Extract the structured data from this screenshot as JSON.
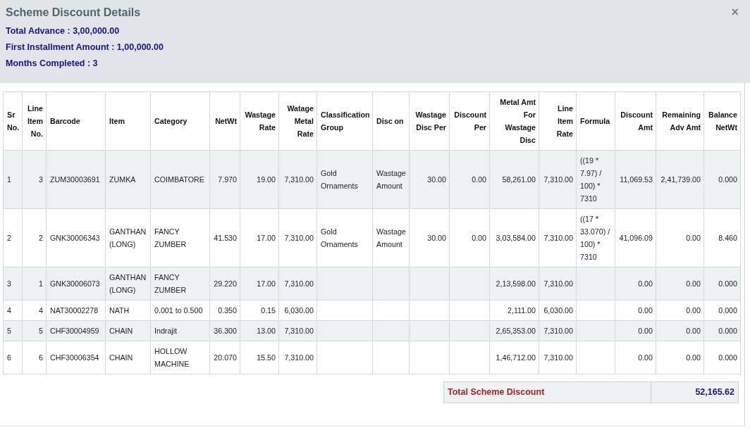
{
  "dialog": {
    "title": "Scheme Discount Details",
    "close": "×",
    "summary": [
      "Total Advance : 3,00,000.00",
      "First Installment Amount : 1,00,000.00",
      "Months Completed : 3"
    ]
  },
  "table": {
    "columns": [
      "Sr No.",
      "Line Item No.",
      "Barcode",
      "Item",
      "Category",
      "NetWt",
      "Wastage Rate",
      "Watage Metal Rate",
      "Classification Group",
      "Disc on",
      "Wastage Disc Per",
      "Discount Per",
      "Metal Amt For Wastage Disc",
      "Line Item Rate",
      "Formula",
      "Discount Amt",
      "Remaining Adv Amt",
      "Balance NetWt"
    ],
    "rows": [
      {
        "sr_no": "1",
        "line_item_no": "3",
        "barcode": "ZUM30003691",
        "item": "ZUMKA",
        "category": "COIMBATORE",
        "net_wt": "7.970",
        "wastage_rate": "19.00",
        "watage_metal_rate": "7,310.00",
        "classification_group": "Gold Ornaments",
        "disc_on": "Wastage Amount",
        "wastage_disc_per": "30.00",
        "discount_per": "0.00",
        "metal_amt_for_wastage_disc": "58,261.00",
        "line_item_rate": "7,310.00",
        "formula": "((19 * 7.97) / 100) * 7310",
        "discount_amt": "11,069.53",
        "remaining_adv_amt": "2,41,739.00",
        "balance_net_wt": "0.000"
      },
      {
        "sr_no": "2",
        "line_item_no": "2",
        "barcode": "GNK30006343",
        "item": "GANTHAN (LONG)",
        "category": "FANCY ZUMBER",
        "net_wt": "41.530",
        "wastage_rate": "17.00",
        "watage_metal_rate": "7,310.00",
        "classification_group": "Gold Ornaments",
        "disc_on": "Wastage Amount",
        "wastage_disc_per": "30.00",
        "discount_per": "0.00",
        "metal_amt_for_wastage_disc": "3,03,584.00",
        "line_item_rate": "7,310.00",
        "formula": "((17 * 33.070) / 100) * 7310",
        "discount_amt": "41,096.09",
        "remaining_adv_amt": "0.00",
        "balance_net_wt": "8.460"
      },
      {
        "sr_no": "3",
        "line_item_no": "1",
        "barcode": "GNK30006073",
        "item": "GANTHAN (LONG)",
        "category": "FANCY ZUMBER",
        "net_wt": "29.220",
        "wastage_rate": "17.00",
        "watage_metal_rate": "7,310.00",
        "metal_amt_for_wastage_disc": "2,13,598.00",
        "line_item_rate": "7,310.00",
        "discount_amt": "0.00",
        "remaining_adv_amt": "0.00",
        "balance_net_wt": "0.000"
      },
      {
        "sr_no": "4",
        "line_item_no": "4",
        "barcode": "NAT30002278",
        "item": "NATH",
        "category": "0.001 to 0.500",
        "net_wt": "0.350",
        "wastage_rate": "0.15",
        "watage_metal_rate": "6,030.00",
        "metal_amt_for_wastage_disc": "2,111.00",
        "line_item_rate": "6,030.00",
        "discount_amt": "0.00",
        "remaining_adv_amt": "0.00",
        "balance_net_wt": "0.000"
      },
      {
        "sr_no": "5",
        "line_item_no": "5",
        "barcode": "CHF30004959",
        "item": "CHAIN",
        "category": "Indrajit",
        "net_wt": "36.300",
        "wastage_rate": "13.00",
        "watage_metal_rate": "7,310.00",
        "metal_amt_for_wastage_disc": "2,65,353.00",
        "line_item_rate": "7,310.00",
        "discount_amt": "0.00",
        "remaining_adv_amt": "0.00",
        "balance_net_wt": "0.000"
      },
      {
        "sr_no": "6",
        "line_item_no": "6",
        "barcode": "CHF30006354",
        "item": "CHAIN",
        "category": "HOLLOW MACHINE",
        "net_wt": "20.070",
        "wastage_rate": "15.50",
        "watage_metal_rate": "7,310.00",
        "metal_amt_for_wastage_disc": "1,46,712.00",
        "line_item_rate": "7,310.00",
        "discount_amt": "0.00",
        "remaining_adv_amt": "0.00",
        "balance_net_wt": "0.000"
      }
    ]
  },
  "total": {
    "label": "Total Scheme Discount",
    "value": "52,165.62"
  }
}
